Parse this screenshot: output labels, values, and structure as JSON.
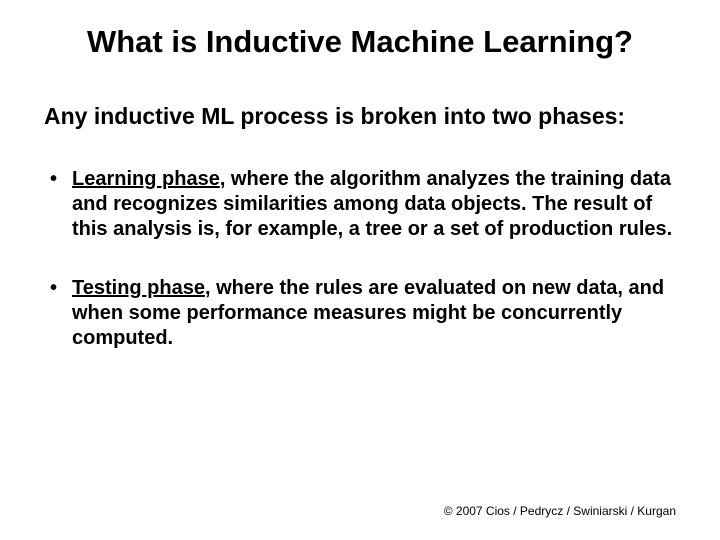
{
  "title": "What is Inductive Machine Learning?",
  "intro": "Any inductive ML process is broken into two phases:",
  "bullets": [
    {
      "phase": "Learning phase",
      "rest": ", where the algorithm analyzes the training data and recognizes similarities among data objects. The result of this analysis is, for example, a tree or a set of production rules."
    },
    {
      "phase": "Testing phase",
      "rest": ", where the rules are evaluated on new data, and when some performance measures might be  concurrently computed."
    }
  ],
  "footer": "© 2007 Cios / Pedrycz / Swiniarski / Kurgan"
}
